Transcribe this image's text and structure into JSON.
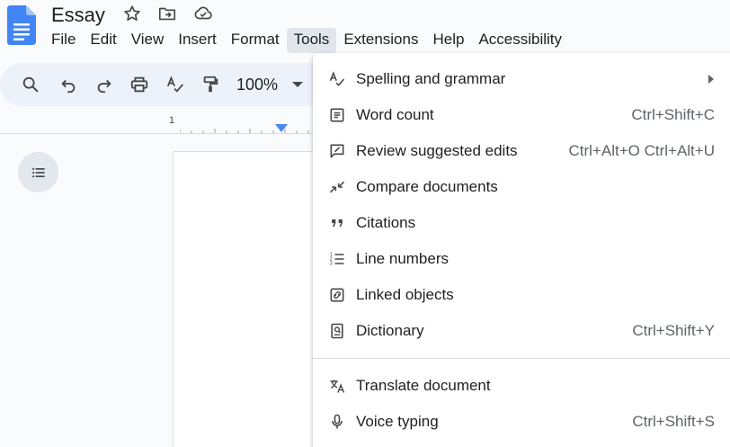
{
  "app": {
    "doc_title": "Essay"
  },
  "menubar": {
    "items": [
      "File",
      "Edit",
      "View",
      "Insert",
      "Format",
      "Tools",
      "Extensions",
      "Help",
      "Accessibility"
    ],
    "active": "Tools"
  },
  "toolbar": {
    "zoom": "100%"
  },
  "ruler": {
    "label": "1"
  },
  "tools_menu": {
    "items": [
      {
        "label": "Spelling and grammar",
        "shortcut": "",
        "icon": "spellcheck-icon",
        "submenu": true
      },
      {
        "label": "Word count",
        "shortcut": "Ctrl+Shift+C",
        "icon": "word-count-icon"
      },
      {
        "label": "Review suggested edits",
        "shortcut": "Ctrl+Alt+O Ctrl+Alt+U",
        "icon": "review-edits-icon"
      },
      {
        "label": "Compare documents",
        "shortcut": "",
        "icon": "compare-icon"
      },
      {
        "label": "Citations",
        "shortcut": "",
        "icon": "quote-icon"
      },
      {
        "label": "Line numbers",
        "shortcut": "",
        "icon": "line-numbers-icon"
      },
      {
        "label": "Linked objects",
        "shortcut": "",
        "icon": "linked-objects-icon"
      },
      {
        "label": "Dictionary",
        "shortcut": "Ctrl+Shift+Y",
        "icon": "dictionary-icon"
      },
      {
        "label": "Translate document",
        "shortcut": "",
        "icon": "translate-icon"
      },
      {
        "label": "Voice typing",
        "shortcut": "Ctrl+Shift+S",
        "icon": "microphone-icon"
      }
    ]
  },
  "colors": {
    "accent": "#4a86f0",
    "docs_blue": "#4285f4",
    "active_menu_bg": "#e1e6ed",
    "toolbar_bg": "#edf2fa"
  }
}
